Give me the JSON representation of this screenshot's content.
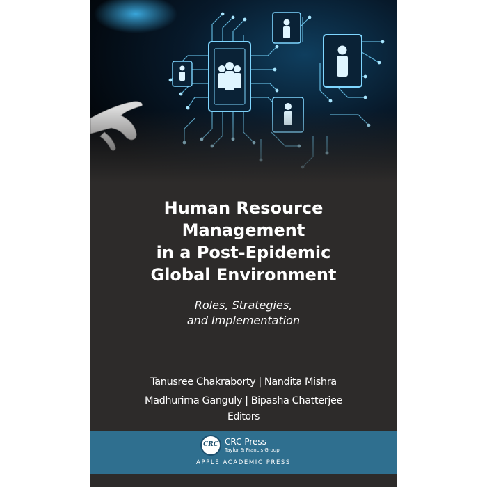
{
  "book": {
    "title_lines": [
      "Human Resource",
      "Management",
      "in a Post-Epidemic",
      "Global Environment"
    ],
    "subtitle_lines": [
      "Roles, Strategies,",
      "and Implementation"
    ],
    "editors": {
      "line1": [
        "Tanusree Chakraborty",
        "Nandita Mishra"
      ],
      "line2": [
        "Madhurima Ganguly",
        "Bipasha Chatterjee"
      ],
      "separator": "|",
      "role": "Editors"
    },
    "publisher": {
      "logo_text": "CRC",
      "name": "CRC Press",
      "group": "Taylor & Francis Group",
      "imprint": "APPLE ACADEMIC PRESS"
    },
    "colors": {
      "cover_background": "#2d2b2a",
      "publisher_band": "#2f6f8f",
      "circuit_glow": "#7fd6ff"
    },
    "cover_art": {
      "icons": [
        "group-people-icon",
        "person-icon",
        "person-icon",
        "person-icon",
        "person-icon",
        "pointing-hand-icon"
      ]
    }
  }
}
